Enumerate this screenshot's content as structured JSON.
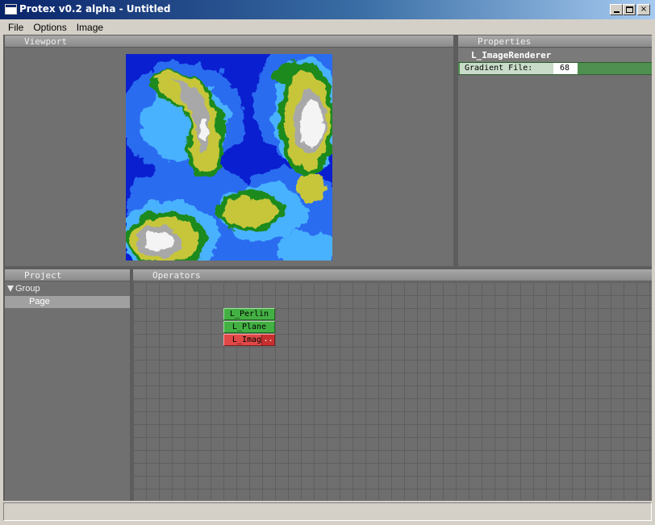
{
  "window": {
    "title": "Protex v0.2 alpha - Untitled",
    "icon": "app-window-icon",
    "minimize_icon": "minimize-icon",
    "maximize_icon": "maximize-icon",
    "close_label": "×",
    "close_icon": "close-icon"
  },
  "menu": {
    "items": [
      "File",
      "Options",
      "Image"
    ]
  },
  "viewport": {
    "header": "Viewport"
  },
  "properties": {
    "header": "Properties",
    "object_name": "L_ImageRenderer",
    "fields": [
      {
        "label": "Gradient File:",
        "value": "68"
      }
    ]
  },
  "project": {
    "header": "Project",
    "tree": {
      "group_label": "Group",
      "children": [
        "Page"
      ]
    }
  },
  "operators": {
    "header": "Operators",
    "nodes": [
      {
        "label": "L_Perlin",
        "color": "#43b043"
      },
      {
        "label": "L_Plane",
        "color": "#43b043"
      },
      {
        "label": "L_Image",
        "suffix": "..",
        "color": "#e04848"
      }
    ]
  },
  "colors": {
    "app_background": "#5d5d5d",
    "panel_background": "#707070",
    "title_gradient_start": "#0a246a",
    "operator_green": "#43b043",
    "operator_red": "#e04848",
    "property_row": "#4f8f4f"
  }
}
